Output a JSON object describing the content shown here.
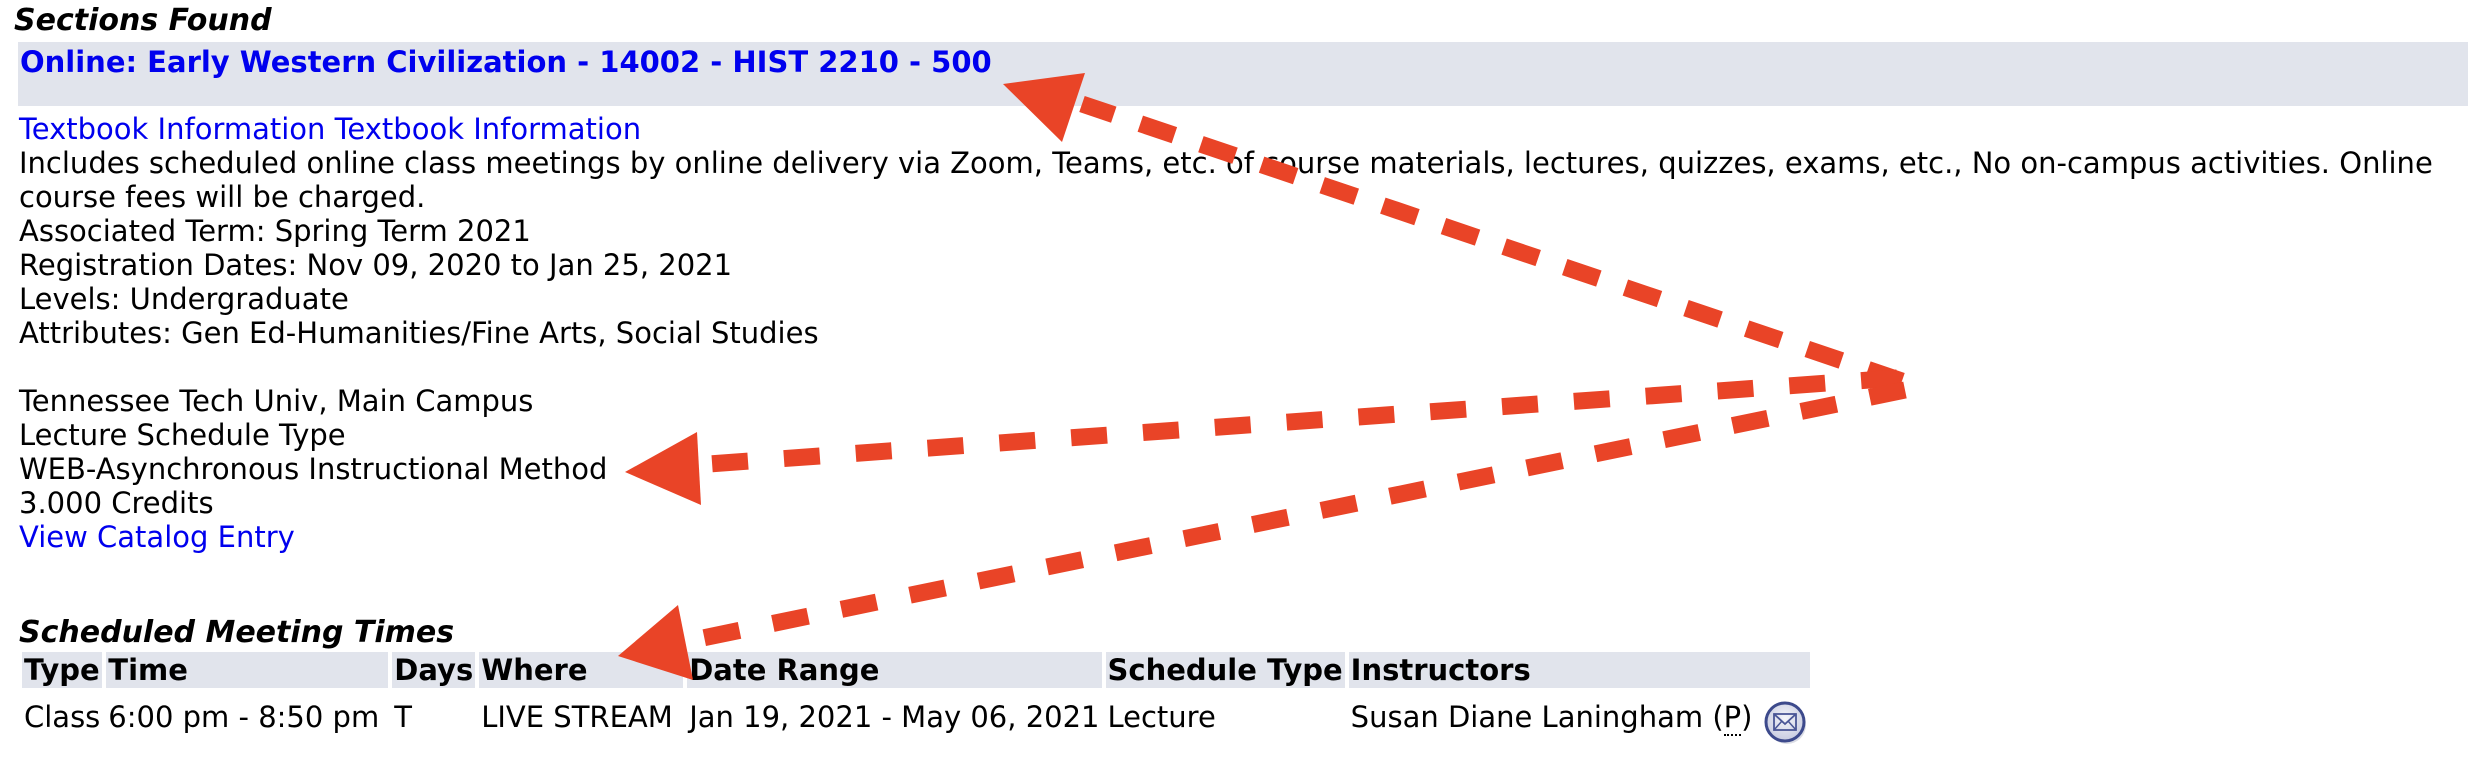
{
  "page": {
    "sections_found_heading": "Sections Found",
    "section_title": "Online: Early Western Civilization - 14002 - HIST 2210 - 500",
    "textbook_link": "Textbook Information Textbook Information",
    "description": "Includes scheduled online class meetings by online delivery via Zoom, Teams, etc. of course materials, lectures, quizzes, exams, etc., No on-campus activities. Online course fees will be charged.",
    "associated_term": "Associated Term: Spring Term 2021",
    "registration_dates": "Registration Dates: Nov 09, 2020 to Jan 25, 2021",
    "levels": "Levels: Undergraduate",
    "attributes": "Attributes: Gen Ed-Humanities/Fine Arts, Social Studies",
    "campus": "Tennessee Tech Univ, Main Campus",
    "schedule_type": "Lecture Schedule Type",
    "instructional_method": "WEB-Asynchronous Instructional Method",
    "credits": "3.000 Credits",
    "catalog_link": "View Catalog Entry"
  },
  "meeting_times": {
    "caption": "Scheduled Meeting Times",
    "headers": [
      "Type",
      "Time",
      "Days",
      "Where",
      "Date Range",
      "Schedule Type",
      "Instructors"
    ],
    "rows": [
      {
        "type": "Class",
        "time": "6:00 pm - 8:50 pm",
        "days": "T",
        "where": "LIVE STREAM",
        "date_range": "Jan 19, 2021 - May 06, 2021",
        "schedule_type": "Lecture",
        "instructor_name": "Susan Diane Laningham",
        "instructor_primary_open": "(",
        "instructor_primary_mark": "P",
        "instructor_primary_close": ")",
        "instructor_email_icon": "envelope-icon"
      }
    ]
  },
  "annotations": {
    "arrow_color": "#e94427",
    "arrow_count": 3,
    "arrow_targets": [
      "section-title",
      "instructional-method",
      "where-column-header"
    ]
  },
  "colors": {
    "link": "#0000ee",
    "header_bg": "#e1e4ec",
    "arrow": "#e94427"
  }
}
